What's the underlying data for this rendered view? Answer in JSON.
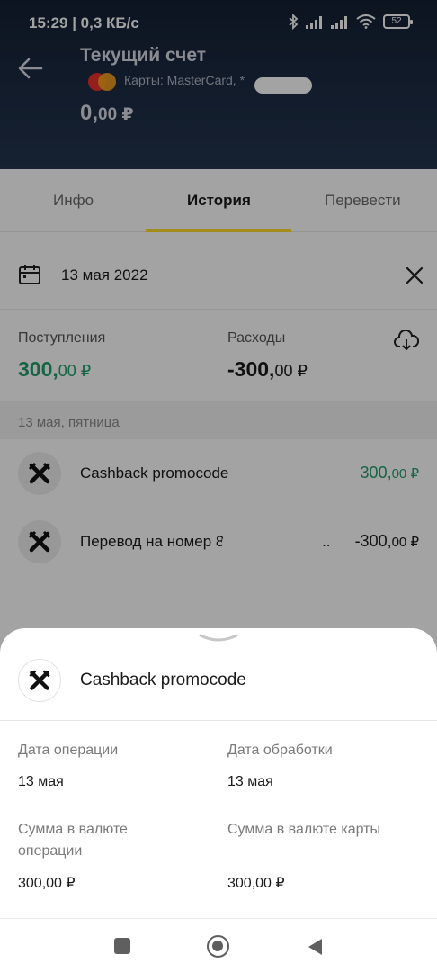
{
  "status_bar": {
    "time_speed": "15:29 | 0,3 КБ/с",
    "battery": "52"
  },
  "header": {
    "title": "Текущий счет",
    "card_info": "Карты: MasterCard, *",
    "balance_int": "0,",
    "balance_dec": "00 ₽"
  },
  "tabs": [
    {
      "label": "Инфо"
    },
    {
      "label": "История"
    },
    {
      "label": "Перевести"
    }
  ],
  "filter": {
    "date": "13 мая 2022"
  },
  "summary": {
    "income_label": "Поступления",
    "income_int": "300,",
    "income_dec": "00 ₽",
    "expense_label": "Расходы",
    "expense_int": "-300,",
    "expense_dec": "00 ₽"
  },
  "day_header": "13 мая, пятница",
  "transactions": [
    {
      "name": "Cashback promocode",
      "amount_int": "300,",
      "amount_dec": "00 ₽"
    },
    {
      "name": "Перевод на номер 8",
      "name_suffix": "...",
      "amount_int": "-300,",
      "amount_dec": "00 ₽"
    }
  ],
  "sheet": {
    "title": "Cashback promocode",
    "op_date_label": "Дата операции",
    "op_date_value": "13 мая",
    "proc_date_label": "Дата обработки",
    "proc_date_value": "13 мая",
    "op_amount_label": "Сумма в валюте операции",
    "op_amount_value": "300,00 ₽",
    "card_amount_label": "Сумма в валюте карты",
    "card_amount_value": "300,00 ₽"
  },
  "colors": {
    "accent": "#fedd2c",
    "income": "#1e9e6a",
    "header_bg": "#1d2c44"
  }
}
